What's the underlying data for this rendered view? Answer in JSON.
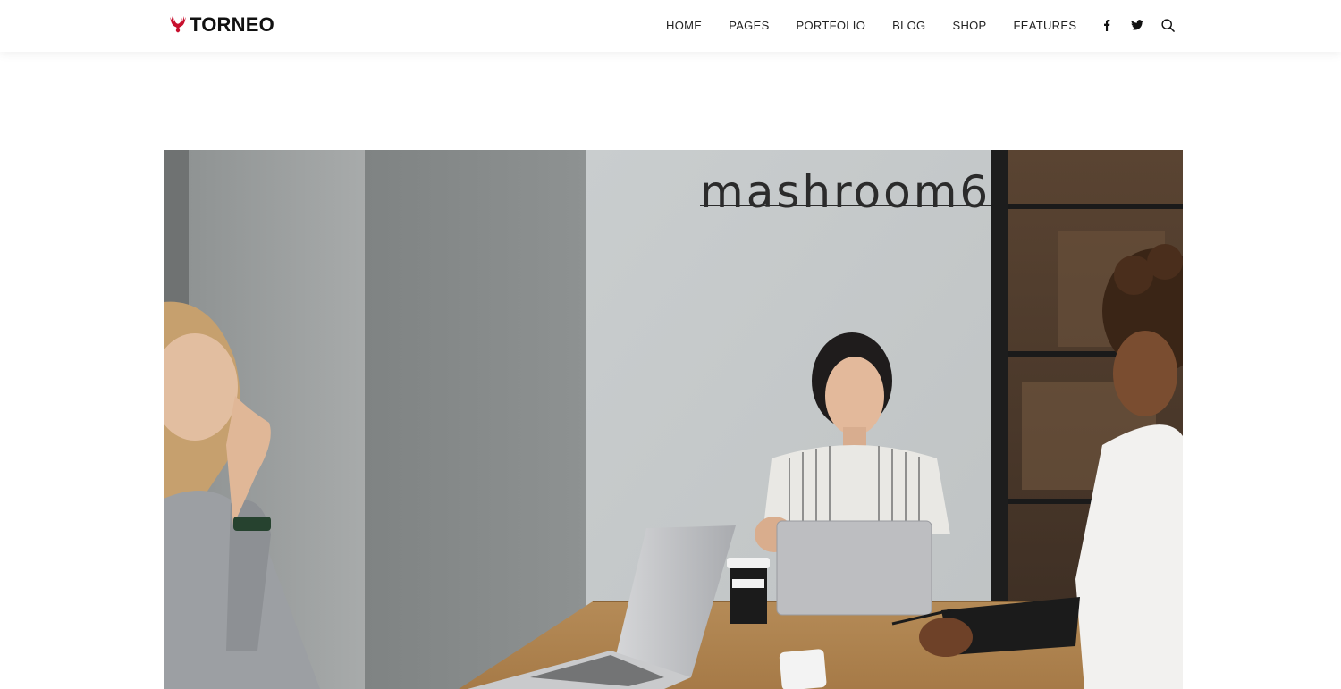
{
  "header": {
    "logo_text": "TORNEO",
    "nav": [
      "HOME",
      "PAGES",
      "PORTFOLIO",
      "BLOG",
      "SHOP",
      "FEATURES"
    ],
    "social": [
      {
        "name": "facebook-icon",
        "glyph": "f"
      },
      {
        "name": "twitter-icon",
        "glyph": "twitter"
      }
    ],
    "search_icon": "search-icon"
  },
  "hero": {
    "sign_text": "mashroom6"
  },
  "colors": {
    "brand_accent": "#c8102e",
    "text": "#222222",
    "background": "#ffffff"
  }
}
